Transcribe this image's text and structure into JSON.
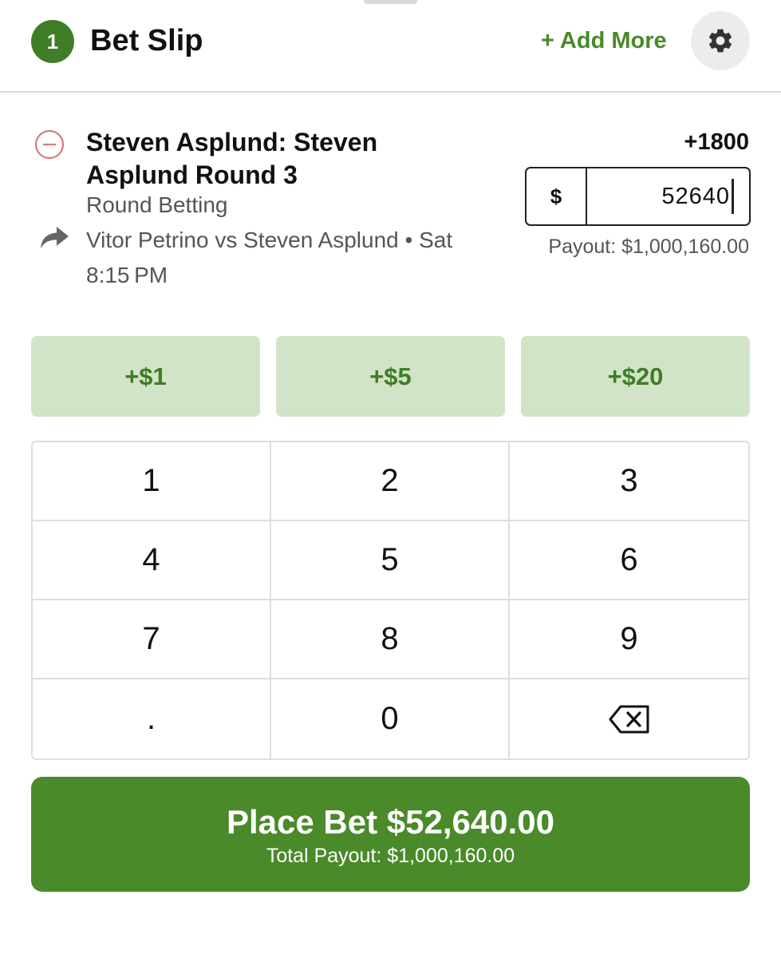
{
  "header": {
    "count": "1",
    "title": "Bet Slip",
    "add_more": "+ Add More"
  },
  "bet": {
    "selection": "Steven Asplund: Steven Asplund Round 3",
    "market": "Round Betting",
    "event": "Vitor Petrino vs Steven Asplund • Sat 8:15 PM",
    "odds": "+1800",
    "currency": "$",
    "wager": "52640",
    "payout": "Payout: $1,000,160.00"
  },
  "quick_add": [
    {
      "label": "+$1"
    },
    {
      "label": "+$5"
    },
    {
      "label": "+$20"
    }
  ],
  "keypad": {
    "keys": [
      "1",
      "2",
      "3",
      "4",
      "5",
      "6",
      "7",
      "8",
      "9",
      ".",
      "0"
    ],
    "backspace_icon": "backspace-icon"
  },
  "place_bet": {
    "label": "Place Bet $52,640.00",
    "total_payout": "Total Payout: $1,000,160.00"
  },
  "colors": {
    "brand_green": "#4a8a2a",
    "badge_green": "#3f7d27",
    "quick_bg": "#d2e4c8",
    "remove_red": "#d97a7a"
  },
  "icons": {
    "settings": "gear-icon",
    "remove": "remove-circle-icon",
    "share": "share-arrow-icon"
  }
}
